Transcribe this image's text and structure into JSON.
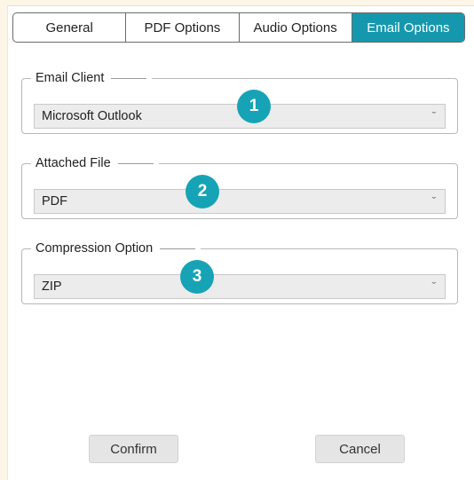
{
  "tabs": [
    {
      "label": "General",
      "active": false
    },
    {
      "label": "PDF Options",
      "active": false
    },
    {
      "label": "Audio Options",
      "active": false
    },
    {
      "label": "Email Options",
      "active": true
    }
  ],
  "groups": {
    "email_client": {
      "legend": "Email Client",
      "value": "Microsoft Outlook",
      "badge": "1"
    },
    "attached_file": {
      "legend": "Attached File",
      "value": "PDF",
      "badge": "2"
    },
    "compression": {
      "legend": "Compression Option",
      "value": "ZIP",
      "badge": "3"
    }
  },
  "buttons": {
    "confirm": "Confirm",
    "cancel": "Cancel"
  },
  "icons": {
    "dropdown": "chevron-down-icon"
  },
  "colors": {
    "accent": "#1598ad",
    "badge": "#17a3b6",
    "background": "#fdf6e6"
  }
}
